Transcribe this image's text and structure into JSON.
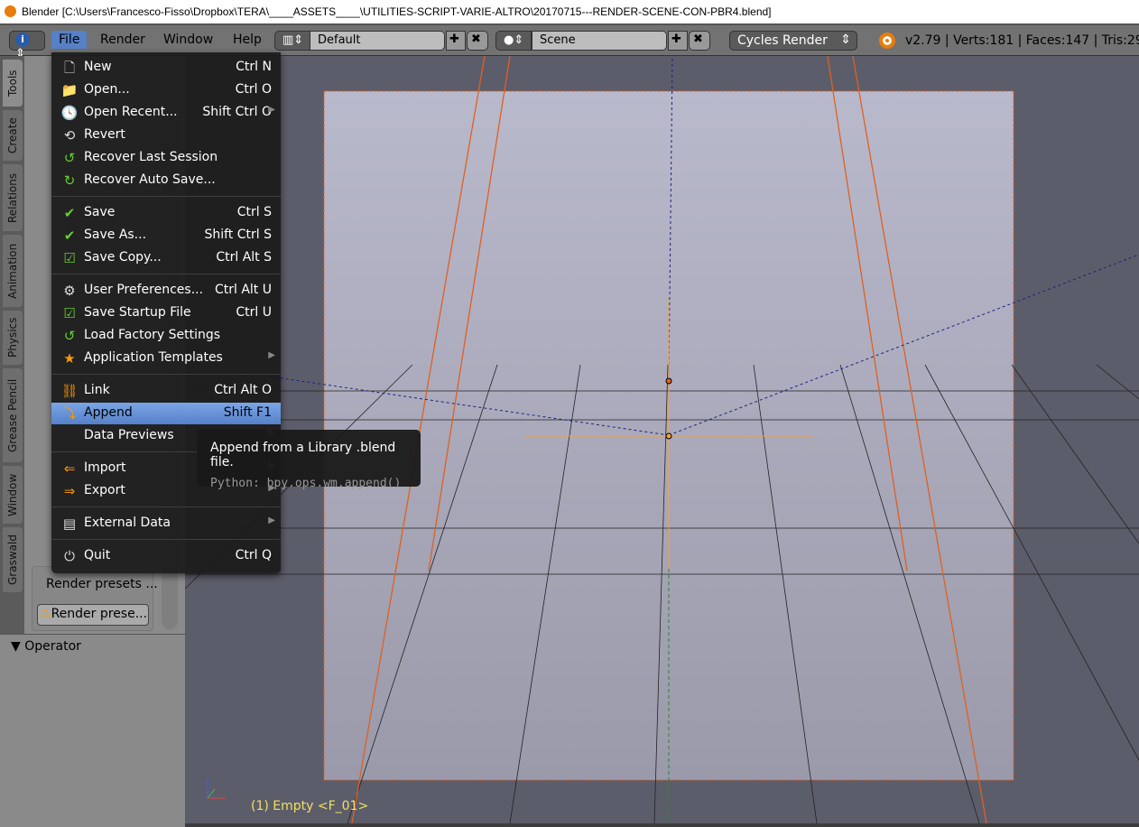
{
  "window": {
    "title": "Blender [C:\\Users\\Francesco-Fisso\\Dropbox\\TERA\\____ASSETS____\\UTILITIES-SCRIPT-VARIE-ALTRO\\20170715---RENDER-SCENE-CON-PBR4.blend]"
  },
  "header": {
    "menus": [
      "File",
      "Render",
      "Window",
      "Help"
    ],
    "layout": "Default",
    "scene": "Scene",
    "engine": "Cycles Render",
    "stats": "v2.79 | Verts:181 | Faces:147 | Tris:294 |"
  },
  "tabs": [
    "Tools",
    "Create",
    "Relations",
    "Animation",
    "Physics",
    "Grease Pencil",
    "Window",
    "Graswald"
  ],
  "shelf": {
    "render_presets_label": "Render presets ...",
    "render_presets_button": "Render prese...",
    "operator_panel": "Operator"
  },
  "file_menu": {
    "items": [
      {
        "label": "New",
        "shortcut": "Ctrl N",
        "icon": "new-file-icon"
      },
      {
        "label": "Open...",
        "shortcut": "Ctrl O",
        "icon": "folder-icon"
      },
      {
        "label": "Open Recent...",
        "shortcut": "Shift Ctrl O",
        "icon": "recent-icon",
        "submenu": true
      },
      {
        "label": "Revert",
        "shortcut": "",
        "icon": "revert-icon"
      },
      {
        "label": "Recover Last Session",
        "shortcut": "",
        "icon": "recover-icon"
      },
      {
        "label": "Recover Auto Save...",
        "shortcut": "",
        "icon": "recover-auto-icon"
      },
      {
        "label": "Save",
        "shortcut": "Ctrl S",
        "icon": "check-icon"
      },
      {
        "label": "Save As...",
        "shortcut": "Shift Ctrl S",
        "icon": "check-icon"
      },
      {
        "label": "Save Copy...",
        "shortcut": "Ctrl Alt S",
        "icon": "save-copy-icon"
      },
      {
        "label": "User Preferences...",
        "shortcut": "Ctrl Alt U",
        "icon": "preferences-icon"
      },
      {
        "label": "Save Startup File",
        "shortcut": "Ctrl U",
        "icon": "save-startup-icon"
      },
      {
        "label": "Load Factory Settings",
        "shortcut": "",
        "icon": "load-factory-icon"
      },
      {
        "label": "Application Templates",
        "shortcut": "",
        "icon": "templates-icon",
        "submenu": true
      },
      {
        "label": "Link",
        "shortcut": "Ctrl Alt O",
        "icon": "link-icon"
      },
      {
        "label": "Append",
        "shortcut": "Shift F1",
        "icon": "append-icon",
        "highlighted": true
      },
      {
        "label": "Data Previews",
        "shortcut": "",
        "icon": "",
        "submenu": true
      },
      {
        "label": "Import",
        "shortcut": "",
        "icon": "import-icon",
        "submenu": true
      },
      {
        "label": "Export",
        "shortcut": "",
        "icon": "export-icon",
        "submenu": true
      },
      {
        "label": "External Data",
        "shortcut": "",
        "icon": "external-data-icon",
        "submenu": true
      },
      {
        "label": "Quit",
        "shortcut": "Ctrl Q",
        "icon": "power-icon"
      }
    ]
  },
  "tooltip": {
    "title": "Append from a Library .blend file.",
    "python": "Python: bpy.ops.wm.append()"
  },
  "viewport": {
    "status": "(1) Empty <F_01>"
  },
  "colors": {
    "highlight": "#5680c8",
    "camera_frame": "#e06020",
    "status_text": "#f0e060"
  }
}
